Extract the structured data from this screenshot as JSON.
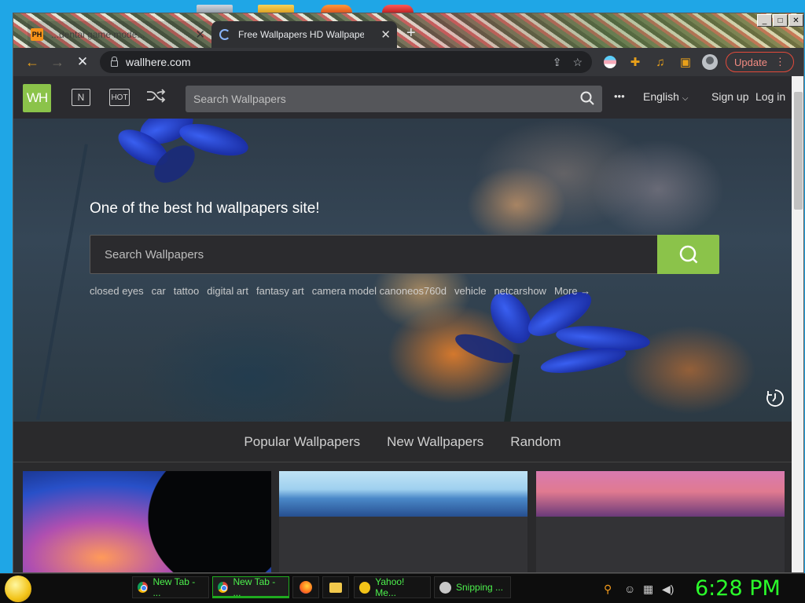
{
  "browser": {
    "tabs": [
      {
        "title": "...dental game mode...",
        "favicon": "PH"
      },
      {
        "title": "Free Wallpapers HD Wallpapers"
      }
    ],
    "tab_close": "✕",
    "new_tab": "+",
    "url": "wallhere.com",
    "update_label": "Update"
  },
  "site": {
    "logo": "WH",
    "nav_new": "N",
    "nav_hot": "HOT",
    "search_placeholder": "Search Wallpapers",
    "more_dots": "•••",
    "language": "English",
    "sign_up": "Sign up",
    "log_in": "Log in"
  },
  "hero": {
    "title": "One of the best hd wallpapers site!",
    "search_placeholder": "Search Wallpapers",
    "tags": [
      "closed eyes",
      "car",
      "tattoo",
      "digital art",
      "fantasy art",
      "camera model canoneos760d",
      "vehicle",
      "netcarshow",
      "More →"
    ]
  },
  "section_tabs": [
    "Popular Wallpapers",
    "New Wallpapers",
    "Random"
  ],
  "taskbar": {
    "tasks": [
      {
        "label": "New Tab - ...",
        "icon": "chrome-icon"
      },
      {
        "label": "New Tab - ...",
        "icon": "chrome-icon"
      },
      {
        "label": "",
        "icon": "firefox-icon"
      },
      {
        "label": "",
        "icon": "folder-icon"
      },
      {
        "label": "Yahoo! Me...",
        "icon": "yahoo-messenger-icon"
      },
      {
        "label": "Snipping ...",
        "icon": "snipping-tool-icon"
      }
    ],
    "clock": "6:28 PM"
  },
  "colors": {
    "brand_green": "#8bc34a",
    "update_red": "#e34a3a",
    "clock_green": "#2bff2b"
  }
}
